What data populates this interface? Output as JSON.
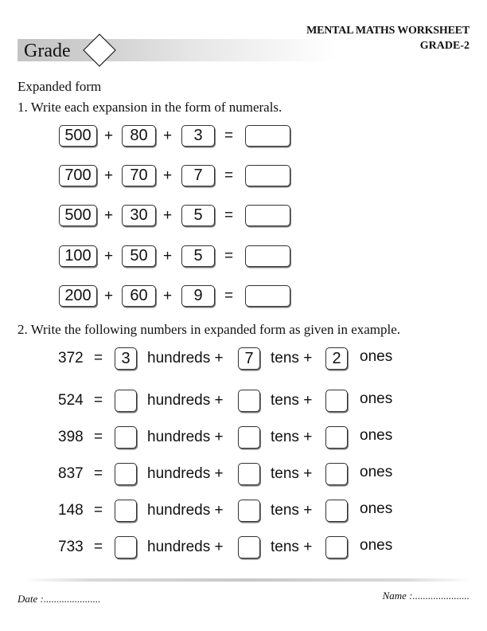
{
  "header": {
    "grade_label": "Grade",
    "title": "MENTAL MATHS WORKSHEET",
    "subtitle": "GRADE-2"
  },
  "section_title": "Expanded form",
  "question1": {
    "title": "1.  Write each expansion in the form of numerals.",
    "plus": "+",
    "equals": "=",
    "rows": [
      {
        "hundreds": "500",
        "tens": "80",
        "ones": "3",
        "answer": ""
      },
      {
        "hundreds": "700",
        "tens": "70",
        "ones": "7",
        "answer": ""
      },
      {
        "hundreds": "500",
        "tens": "30",
        "ones": "5",
        "answer": ""
      },
      {
        "hundreds": "100",
        "tens": "50",
        "ones": "5",
        "answer": ""
      },
      {
        "hundreds": "200",
        "tens": "60",
        "ones": "9",
        "answer": ""
      }
    ]
  },
  "question2": {
    "title": "2.  Write the following numbers in expanded form as given in example.",
    "equals": "=",
    "hundreds_label": "hundreds +",
    "tens_label": "tens +",
    "ones_label": "ones",
    "rows": [
      {
        "number": "372",
        "hundreds": "3",
        "tens": "7",
        "ones": "2"
      },
      {
        "number": "524",
        "hundreds": "",
        "tens": "",
        "ones": ""
      },
      {
        "number": "398",
        "hundreds": "",
        "tens": "",
        "ones": ""
      },
      {
        "number": "837",
        "hundreds": "",
        "tens": "",
        "ones": ""
      },
      {
        "number": "148",
        "hundreds": "",
        "tens": "",
        "ones": ""
      },
      {
        "number": "733",
        "hundreds": "",
        "tens": "",
        "ones": ""
      }
    ]
  },
  "footer": {
    "date_label": "Date :......................",
    "name_label": "Name :......................"
  }
}
